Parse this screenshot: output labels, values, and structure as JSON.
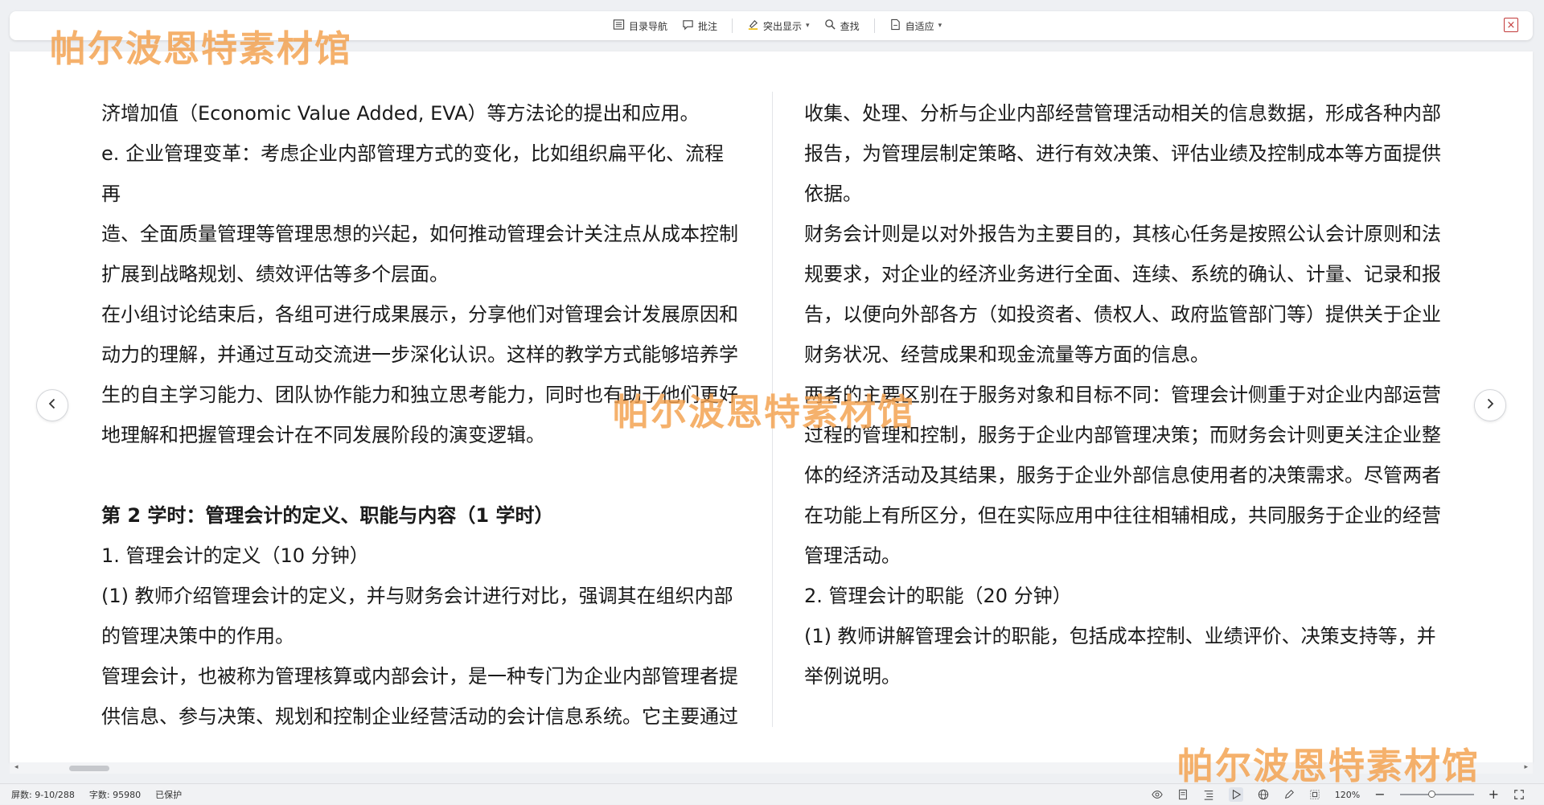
{
  "toolbar": {
    "toc_label": "目录导航",
    "comment_label": "批注",
    "highlight_label": "突出显示",
    "find_label": "查找",
    "fit_label": "自适应"
  },
  "document": {
    "left_column": [
      {
        "text": "济增加值（Economic Value Added, EVA）等方法论的提出和应用。",
        "style": "normal"
      },
      {
        "text": "e. 企业管理变革：考虑企业内部管理方式的变化，比如组织扁平化、流程再",
        "style": "normal"
      },
      {
        "text": "造、全面质量管理等管理思想的兴起，如何推动管理会计关注点从成本控制",
        "style": "normal"
      },
      {
        "text": "扩展到战略规划、绩效评估等多个层面。",
        "style": "normal"
      },
      {
        "text": "在小组讨论结束后，各组可进行成果展示，分享他们对管理会计发展原因和",
        "style": "normal"
      },
      {
        "text": "动力的理解，并通过互动交流进一步深化认识。这样的教学方式能够培养学",
        "style": "normal"
      },
      {
        "text": "生的自主学习能力、团队协作能力和独立思考能力，同时也有助于他们更好",
        "style": "normal"
      },
      {
        "text": "地理解和把握管理会计在不同发展阶段的演变逻辑。",
        "style": "normal"
      },
      {
        "text": "",
        "style": "blank"
      },
      {
        "text": "第 2 学时：管理会计的定义、职能与内容（1 学时）",
        "style": "bold"
      },
      {
        "text": "1. 管理会计的定义（10 分钟）",
        "style": "normal"
      },
      {
        "text": "(1) 教师介绍管理会计的定义，并与财务会计进行对比，强调其在组织内部",
        "style": "normal"
      },
      {
        "text": "的管理决策中的作用。",
        "style": "normal"
      },
      {
        "text": "管理会计，也被称为管理核算或内部会计，是一种专门为企业内部管理者提",
        "style": "normal"
      },
      {
        "text": "供信息、参与决策、规划和控制企业经营活动的会计信息系统。它主要通过",
        "style": "normal"
      }
    ],
    "right_column": [
      {
        "text": "收集、处理、分析与企业内部经营管理活动相关的信息数据，形成各种内部",
        "style": "normal"
      },
      {
        "text": "报告，为管理层制定策略、进行有效决策、评估业绩及控制成本等方面提供",
        "style": "normal"
      },
      {
        "text": "依据。",
        "style": "normal"
      },
      {
        "text": "财务会计则是以对外报告为主要目的，其核心任务是按照公认会计原则和法",
        "style": "normal"
      },
      {
        "text": "规要求，对企业的经济业务进行全面、连续、系统的确认、计量、记录和报",
        "style": "normal"
      },
      {
        "text": "告，以便向外部各方（如投资者、债权人、政府监管部门等）提供关于企业",
        "style": "normal"
      },
      {
        "text": "财务状况、经营成果和现金流量等方面的信息。",
        "style": "normal"
      },
      {
        "text": "两者的主要区别在于服务对象和目标不同：管理会计侧重于对企业内部运营",
        "style": "normal"
      },
      {
        "text": "过程的管理和控制，服务于企业内部管理决策；而财务会计则更关注企业整",
        "style": "normal"
      },
      {
        "text": "体的经济活动及其结果，服务于企业外部信息使用者的决策需求。尽管两者",
        "style": "normal"
      },
      {
        "text": "在功能上有所区分，但在实际应用中往往相辅相成，共同服务于企业的经营",
        "style": "normal"
      },
      {
        "text": "管理活动。",
        "style": "normal"
      },
      {
        "text": "2. 管理会计的职能（20 分钟）",
        "style": "normal"
      },
      {
        "text": "(1) 教师讲解管理会计的职能，包括成本控制、业绩评价、决策支持等，并",
        "style": "normal"
      },
      {
        "text": "举例说明。",
        "style": "normal"
      }
    ]
  },
  "watermark": {
    "text": "帕尔波恩特素材馆",
    "color": "#f3a04c"
  },
  "statusbar": {
    "page": "屏数: 9-10/288",
    "wordcount": "字数: 95980",
    "protect": "已保护",
    "zoom": "120%",
    "zoom_level": 0.43
  }
}
